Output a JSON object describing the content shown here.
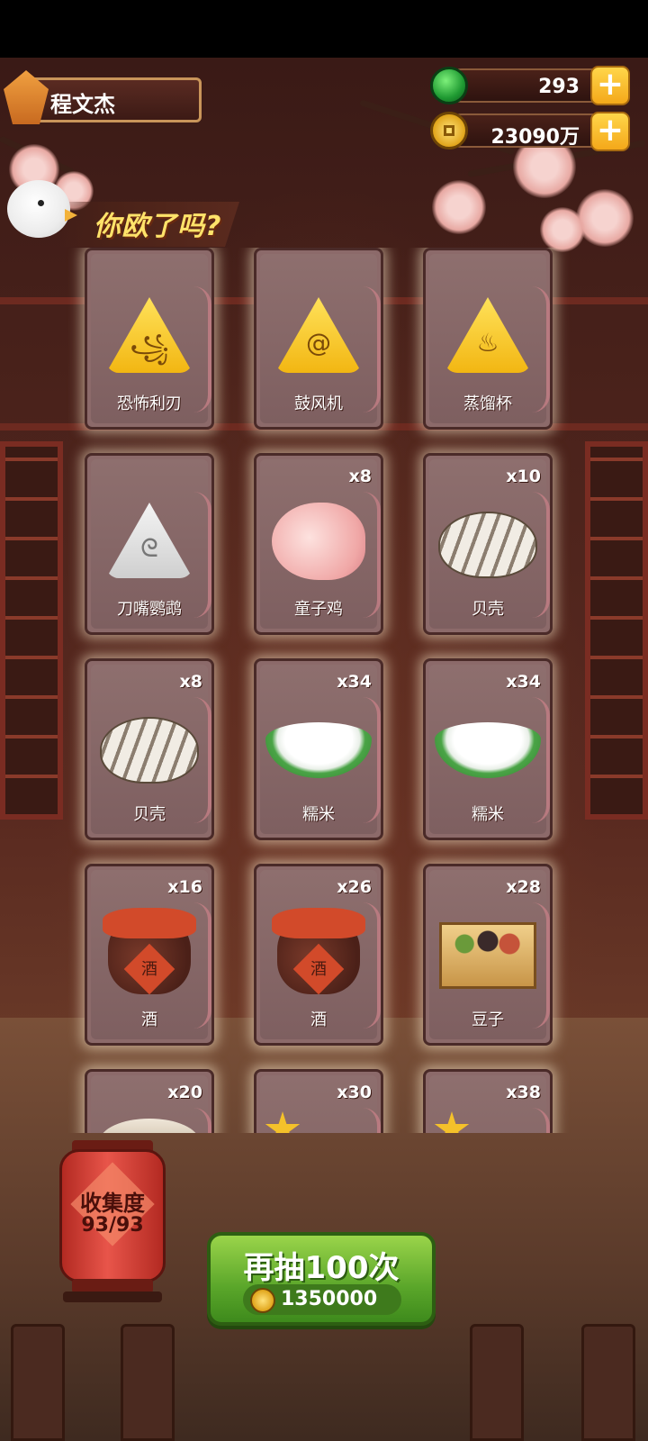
{
  "header": {
    "player_name": "程文杰",
    "resources": [
      {
        "icon": "jade-gem-icon",
        "value": "293"
      },
      {
        "icon": "gold-coin-icon",
        "value": "23090万"
      }
    ],
    "plus_symbol": "+"
  },
  "banner": {
    "text": "你欧了吗?"
  },
  "cards": [
    {
      "name": "恐怖利刃",
      "count": "",
      "icon": "gold-rune-claw-icon"
    },
    {
      "name": "鼓风机",
      "count": "",
      "icon": "gold-rune-spiral-icon"
    },
    {
      "name": "蒸馏杯",
      "count": "",
      "icon": "gold-rune-cup-icon"
    },
    {
      "name": "刀嘴鹦鹉",
      "count": "",
      "icon": "white-rune-parrot-icon"
    },
    {
      "name": "童子鸡",
      "count": "x8",
      "icon": "chick-icon"
    },
    {
      "name": "贝壳",
      "count": "x10",
      "icon": "shell-icon"
    },
    {
      "name": "贝壳",
      "count": "x8",
      "icon": "shell-icon"
    },
    {
      "name": "糯米",
      "count": "x34",
      "icon": "rice-icon"
    },
    {
      "name": "糯米",
      "count": "x34",
      "icon": "rice-icon"
    },
    {
      "name": "酒",
      "count": "x16",
      "icon": "wine-jar-icon"
    },
    {
      "name": "酒",
      "count": "x26",
      "icon": "wine-jar-icon"
    },
    {
      "name": "豆子",
      "count": "x28",
      "icon": "beans-box-icon"
    },
    {
      "name": "",
      "count": "x20",
      "icon": "grain-pile-icon"
    },
    {
      "name": "",
      "count": "x30",
      "icon": "star-leaf-icon"
    },
    {
      "name": "",
      "count": "x38",
      "icon": "star-leaf-icon"
    }
  ],
  "glyphs": {
    "rune_claw": "꧁",
    "rune_spiral": "@",
    "rune_cup": "♨",
    "rune_parrot": "ᘓ",
    "jar": "酒"
  },
  "collection": {
    "title": "收集度",
    "value": "93/93"
  },
  "draw_button": {
    "label": "再抽100次",
    "cost": "1350000"
  },
  "colors": {
    "gold": "#f2b612",
    "green_button": "#5aa62a",
    "card": "#8c6a6a",
    "lantern": "#e8554a"
  }
}
